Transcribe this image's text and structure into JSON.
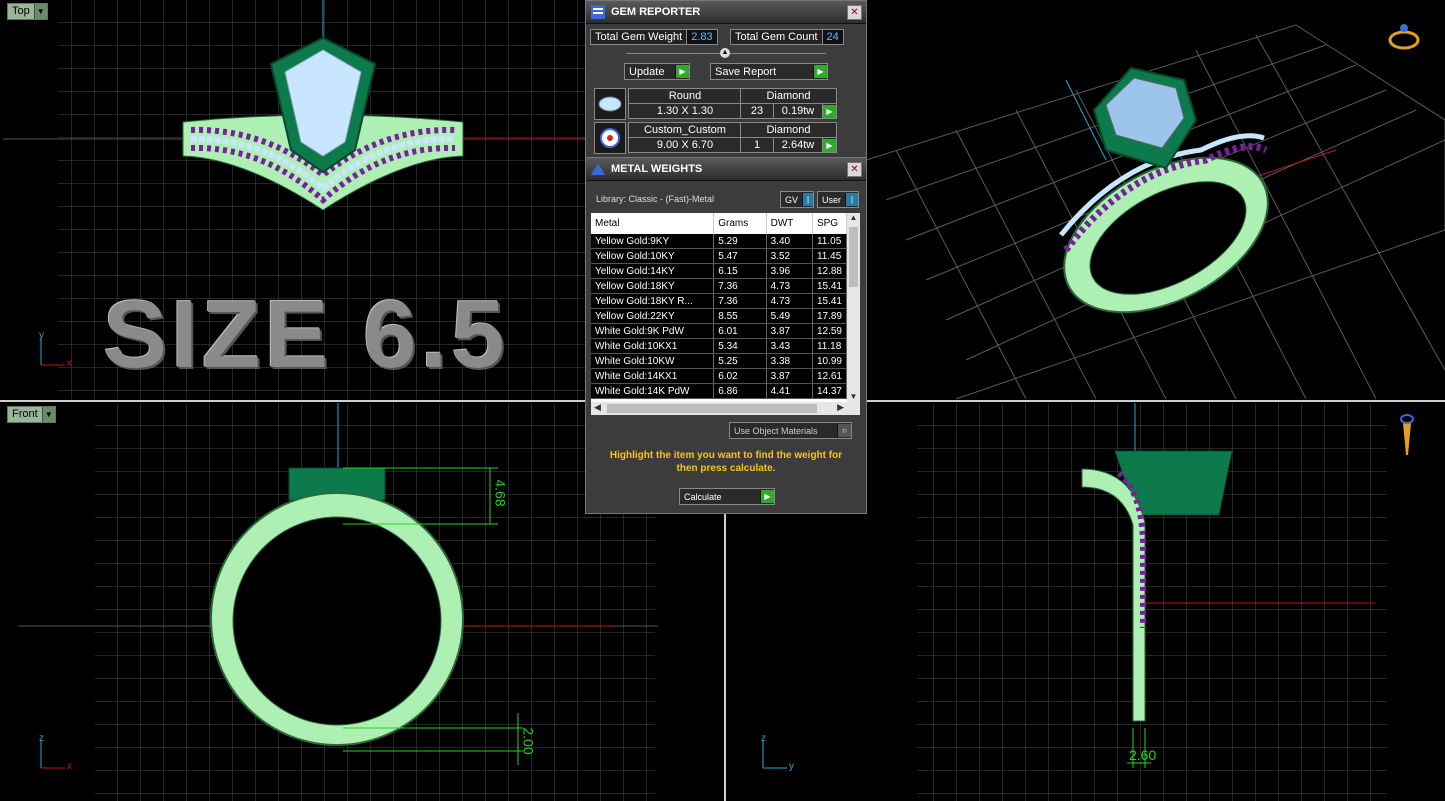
{
  "viewports": {
    "top": {
      "label": "Top",
      "size_text": "SIZE 6.5",
      "axis_y": "y",
      "axis_x": "x"
    },
    "front": {
      "label": "Front",
      "dim_top": "4.68",
      "dim_bottom": "2.00",
      "axis_z": "z",
      "axis_x": "x"
    },
    "right": {
      "dim_bottom": "2.60",
      "axis_z": "z",
      "axis_y": "y"
    }
  },
  "gem_reporter": {
    "title": "GEM REPORTER",
    "total_weight_label": "Total Gem Weight",
    "total_weight_value": "2.83",
    "total_count_label": "Total Gem Count",
    "total_count_value": "24",
    "update_label": "Update",
    "save_label": "Save Report",
    "gems": [
      {
        "shape": "Round",
        "material": "Diamond",
        "size": "1.30 X 1.30",
        "count": "23",
        "weight": "0.19tw"
      },
      {
        "shape": "Custom_Custom",
        "material": "Diamond",
        "size": "9.00 X 6.70",
        "count": "1",
        "weight": "2.64tw"
      }
    ]
  },
  "metal_weights": {
    "title": "METAL WEIGHTS",
    "library": "Library: Classic - (Fast)-Metal",
    "gv_label": "GV",
    "user_label": "User",
    "columns": [
      "Metal",
      "Grams",
      "DWT",
      "SPG"
    ],
    "rows": [
      [
        "Yellow Gold:9KY",
        "5.29",
        "3.40",
        "11.05"
      ],
      [
        "Yellow Gold:10KY",
        "5.47",
        "3.52",
        "11.45"
      ],
      [
        "Yellow Gold:14KY",
        "6.15",
        "3.96",
        "12.88"
      ],
      [
        "Yellow Gold:18KY",
        "7.36",
        "4.73",
        "15.41"
      ],
      [
        "Yellow Gold:18KY R...",
        "7.36",
        "4.73",
        "15.41"
      ],
      [
        "Yellow Gold:22KY",
        "8.55",
        "5.49",
        "17.89"
      ],
      [
        "White Gold:9K PdW",
        "6.01",
        "3.87",
        "12.59"
      ],
      [
        "White Gold:10KX1",
        "5.34",
        "3.43",
        "11.18"
      ],
      [
        "White Gold:10KW",
        "5.25",
        "3.38",
        "10.99"
      ],
      [
        "White Gold:14KX1",
        "6.02",
        "3.87",
        "12.61"
      ],
      [
        "White Gold:14K PdW",
        "6.86",
        "4.41",
        "14.37"
      ]
    ],
    "use_object_label": "Use Object Materials",
    "hint": "Highlight the item you want to find the weight for then press calculate.",
    "calculate_label": "Calculate"
  },
  "colors": {
    "metal": "#aef0b4",
    "setting": "#0d7a4c",
    "stone": "#c8e6ff",
    "prong_gems": "#7a1fa0",
    "dim": "#22d422"
  }
}
